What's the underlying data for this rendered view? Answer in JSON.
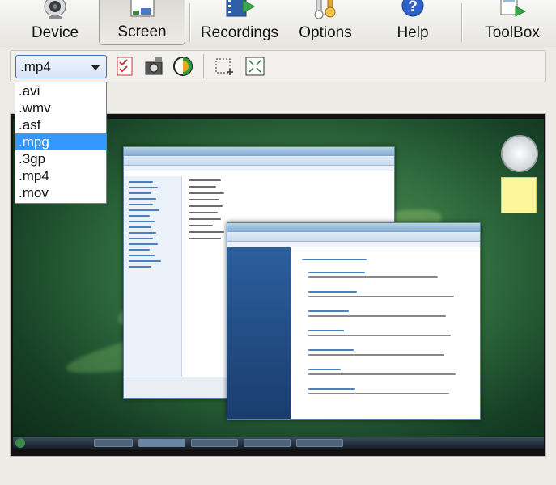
{
  "toolbar": {
    "device_label": "Device",
    "screen_label": "Screen",
    "recordings_label": "Recordings",
    "options_label": "Options",
    "help_label": "Help",
    "toolbox_label": "ToolBox"
  },
  "format_select": {
    "value": ".mp4",
    "options": [
      ".avi",
      ".wmv",
      ".asf",
      ".mpg",
      ".3gp",
      ".mp4",
      ".mov"
    ],
    "highlighted": ".mpg"
  },
  "subtoolbar": {
    "icons": [
      "checklist-icon",
      "camera-settings-icon",
      "color-wheel-icon",
      "select-region-icon",
      "fit-screen-icon"
    ]
  },
  "colors": {
    "accent": "#3399ff",
    "desktop_green": "#2f6b3e"
  }
}
